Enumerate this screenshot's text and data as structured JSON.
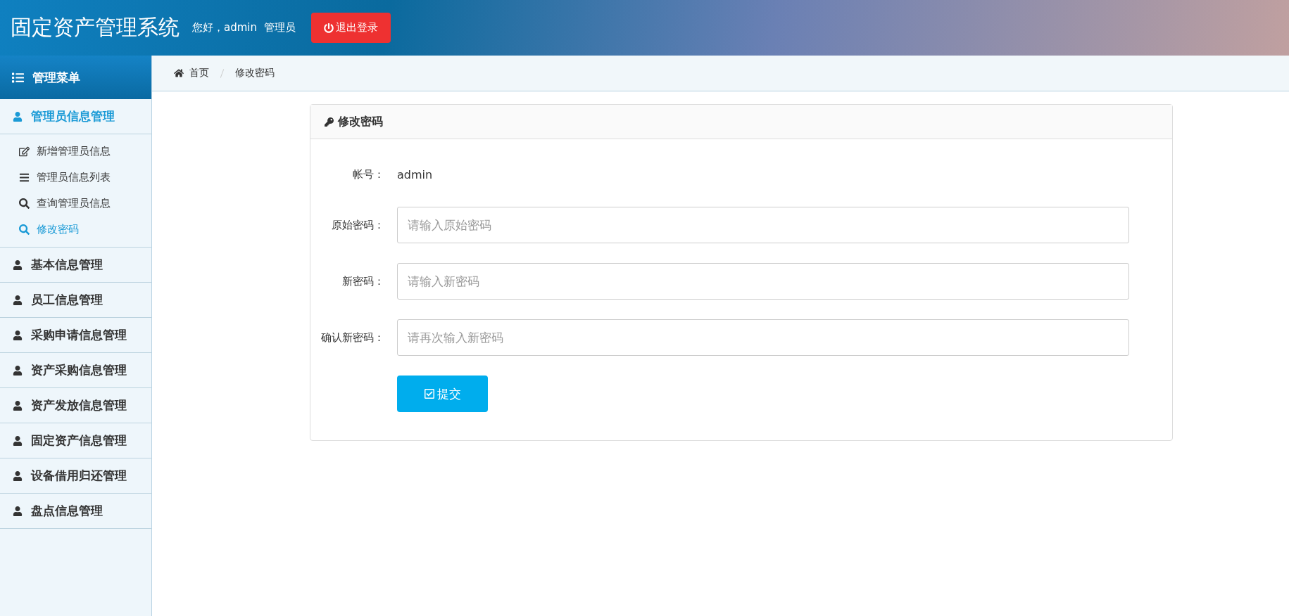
{
  "header": {
    "title": "固定资产管理系统",
    "greeting": "您好，admin",
    "role": "管理员",
    "logout": "退出登录"
  },
  "sidebar": {
    "title": "管理菜单",
    "groups": [
      {
        "label": "管理员信息管理",
        "expanded": true,
        "children": [
          {
            "label": "新增管理员信息",
            "kind": "edit",
            "selected": false
          },
          {
            "label": "管理员信息列表",
            "kind": "list",
            "selected": false
          },
          {
            "label": "查询管理员信息",
            "kind": "search",
            "selected": false
          },
          {
            "label": "修改密码",
            "kind": "search",
            "selected": true
          }
        ]
      },
      {
        "label": "基本信息管理",
        "expanded": false
      },
      {
        "label": "员工信息管理",
        "expanded": false
      },
      {
        "label": "采购申请信息管理",
        "expanded": false
      },
      {
        "label": "资产采购信息管理",
        "expanded": false
      },
      {
        "label": "资产发放信息管理",
        "expanded": false
      },
      {
        "label": "固定资产信息管理",
        "expanded": false
      },
      {
        "label": "设备借用归还管理",
        "expanded": false
      },
      {
        "label": "盘点信息管理",
        "expanded": false
      }
    ]
  },
  "breadcrumb": [
    "首页",
    "修改密码"
  ],
  "panel": {
    "title": "修改密码",
    "fields": [
      {
        "kind": "text",
        "label": "帐号：",
        "value": "admin"
      },
      {
        "kind": "input",
        "label": "原始密码：",
        "placeholder": "请输入原始密码"
      },
      {
        "kind": "input",
        "label": "新密码：",
        "placeholder": "请输入新密码"
      },
      {
        "kind": "input",
        "label": "确认新密码：",
        "placeholder": "请再次输入新密码"
      }
    ],
    "submit": "提交"
  }
}
